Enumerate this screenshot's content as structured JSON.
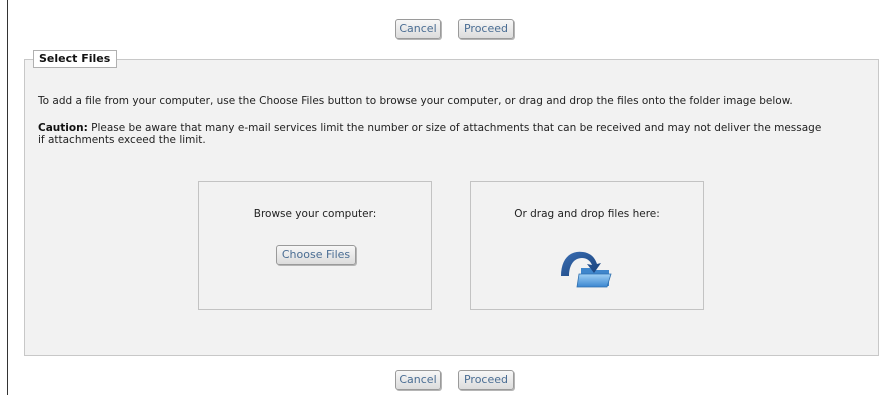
{
  "toolbar_top": {
    "cancel_label": "Cancel",
    "proceed_label": "Proceed"
  },
  "toolbar_bottom": {
    "cancel_label": "Cancel",
    "proceed_label": "Proceed"
  },
  "select_files": {
    "legend": "Select Files",
    "intro": "To add a file from your computer, use the Choose Files button to browse your computer, or drag and drop the files onto the folder image below.",
    "caution_label": "Caution:",
    "caution_text": " Please be aware that many e-mail services limit the number or size of attachments that can be received and may not deliver the message if attachments exceed the limit.",
    "browse": {
      "label": "Browse your computer:",
      "button_label": "Choose Files"
    },
    "drop": {
      "label": "Or drag and drop files here:",
      "icon": "folder-drop-icon"
    }
  },
  "colors": {
    "button_text": "#4a6d93",
    "panel_bg": "#f2f2f2",
    "arrow_blue": "#1f4f8f",
    "folder_blue": "#5fa3e0"
  }
}
